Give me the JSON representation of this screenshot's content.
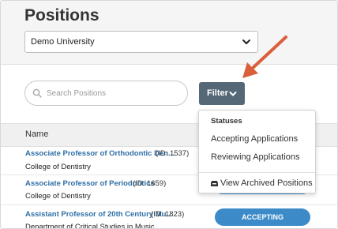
{
  "header": {
    "title": "Positions",
    "university_select": "Demo University"
  },
  "toolbar": {
    "search_placeholder": "Search Positions",
    "filter_label": "Filter"
  },
  "table": {
    "column_name": "Name",
    "rows": [
      {
        "title": "Associate Professor of Orthodontic Den...",
        "id": "(ID: 1537)",
        "department": "College of Dentistry"
      },
      {
        "title": "Associate Professor of Periodontics",
        "id": "(ID: 1659)",
        "department": "College of Dentistry"
      },
      {
        "title": "Assistant Professor of 20th Century Mu...",
        "id": "(ID: 1823)",
        "department": "Department of Critical Studies in Music",
        "status": "ACCEPTING APPLICATIONS"
      }
    ]
  },
  "filter_menu": {
    "heading": "Statuses",
    "items": [
      "Accepting Applications",
      "Reviewing Applications"
    ],
    "archived_label": "View Archived Positions"
  },
  "colors": {
    "filter_button": "#546877",
    "link": "#2f6ea5",
    "status_pill": "#3c8ac7",
    "annotation_arrow": "#d9603b"
  }
}
